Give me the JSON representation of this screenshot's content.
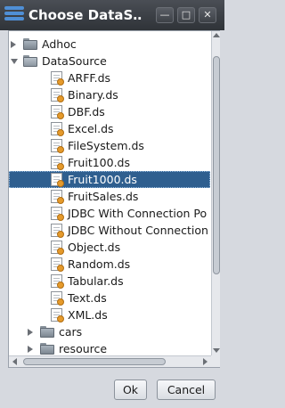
{
  "window": {
    "title": "Choose DataS…",
    "minimize_glyph": "—",
    "maximize_glyph": "□",
    "close_glyph": "✕"
  },
  "tree": {
    "items": [
      {
        "label": "Adhoc",
        "type": "folder",
        "expanded": false,
        "level": 1
      },
      {
        "label": "DataSource",
        "type": "folder",
        "expanded": true,
        "level": 1
      },
      {
        "label": "ARFF.ds",
        "type": "file",
        "level": 2
      },
      {
        "label": "Binary.ds",
        "type": "file",
        "level": 2
      },
      {
        "label": "DBF.ds",
        "type": "file",
        "level": 2
      },
      {
        "label": "Excel.ds",
        "type": "file",
        "level": 2
      },
      {
        "label": "FileSystem.ds",
        "type": "file",
        "level": 2
      },
      {
        "label": "Fruit100.ds",
        "type": "file",
        "level": 2
      },
      {
        "label": "Fruit1000.ds",
        "type": "file",
        "level": 2,
        "selected": true
      },
      {
        "label": "FruitSales.ds",
        "type": "file",
        "level": 2
      },
      {
        "label": "JDBC With Connection Po",
        "type": "file",
        "level": 2
      },
      {
        "label": "JDBC Without Connection",
        "type": "file",
        "level": 2
      },
      {
        "label": "Object.ds",
        "type": "file",
        "level": 2
      },
      {
        "label": "Random.ds",
        "type": "file",
        "level": 2
      },
      {
        "label": "Tabular.ds",
        "type": "file",
        "level": 2
      },
      {
        "label": "Text.ds",
        "type": "file",
        "level": 2
      },
      {
        "label": "XML.ds",
        "type": "file",
        "level": 2
      },
      {
        "label": "cars",
        "type": "folder",
        "expanded": false,
        "level": 2
      },
      {
        "label": "resource",
        "type": "folder",
        "expanded": false,
        "level": 2
      }
    ]
  },
  "buttons": {
    "ok": "Ok",
    "cancel": "Cancel"
  },
  "colors": {
    "selection": "#2f5f8f",
    "accent": "#4f8fd6"
  }
}
